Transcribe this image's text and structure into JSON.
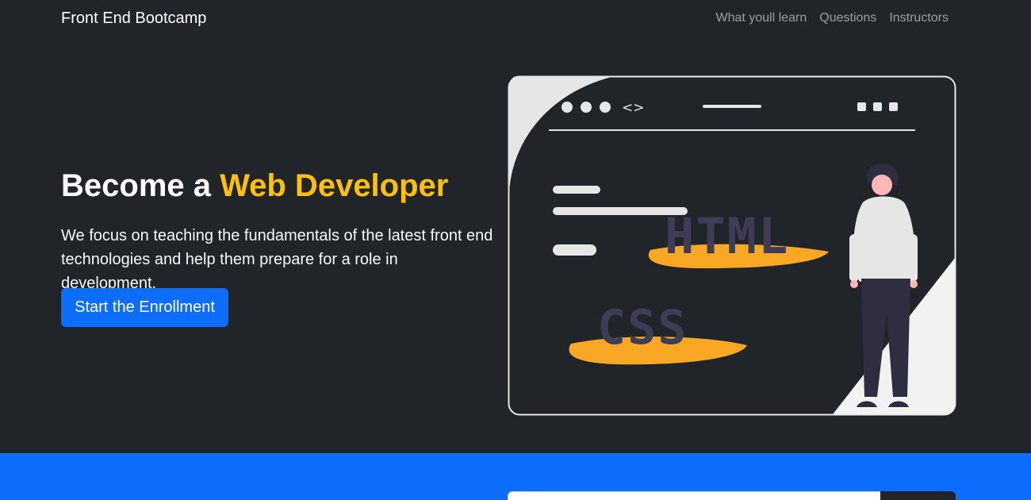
{
  "navbar": {
    "brand": "Front End Bootcamp",
    "links": [
      {
        "label": "What youll learn"
      },
      {
        "label": "Questions"
      },
      {
        "label": "Instructors"
      }
    ]
  },
  "hero": {
    "title_prefix": "Become a ",
    "title_accent": "Web Developer",
    "lead": "We focus on teaching the fundamentals of the latest front end technologies and help them prepare for a role in development.",
    "cta_label": "Start the Enrollment"
  },
  "illustration": {
    "code_symbol": "<>",
    "label_html": "HTML",
    "label_css": "CSS"
  },
  "colors": {
    "background": "#212529",
    "accent": "#ffc107",
    "primary": "#0d6efd",
    "text": "#f8f9fa"
  }
}
